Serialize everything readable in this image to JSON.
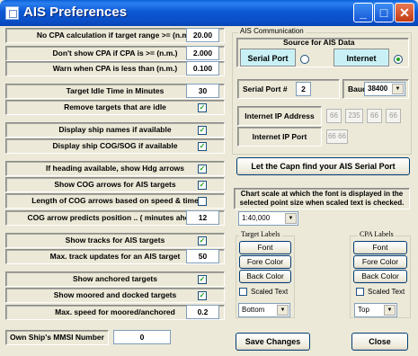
{
  "window": {
    "title": "AIS Preferences",
    "minimize_glyph": "_",
    "maximize_glyph": "□",
    "close_glyph": "✕"
  },
  "settings": [
    {
      "label": "No CPA calculation if target range >=       (n.m.)",
      "value": "20.00",
      "type": "text"
    },
    {
      "label": "Don't show CPA if CPA is >=       (n.m.)",
      "value": "2.000",
      "type": "text"
    },
    {
      "label": "Warn when CPA is less than       (n.m.)",
      "value": "0.100",
      "type": "text"
    },
    {
      "label": "Target Idle Time in Minutes",
      "value": "30",
      "type": "text"
    },
    {
      "label": "Remove targets that are idle",
      "checked": true,
      "type": "check"
    },
    {
      "label": "Display ship names if available",
      "checked": true,
      "type": "check"
    },
    {
      "label": "Display ship COG/SOG if available",
      "checked": true,
      "type": "check"
    },
    {
      "label": "If heading available, show Hdg arrows",
      "checked": true,
      "type": "check"
    },
    {
      "label": "Show COG arrows for AIS targets",
      "checked": true,
      "type": "check"
    },
    {
      "label": "Length of COG arrows based on speed & time",
      "checked": false,
      "type": "check"
    },
    {
      "label": "COG arrow predicts position .. ( minutes ahead )",
      "value": "12",
      "type": "text"
    },
    {
      "label": "Show tracks for AIS targets",
      "checked": true,
      "type": "check"
    },
    {
      "label": "Max. track updates for an AIS target",
      "value": "50",
      "type": "text"
    },
    {
      "label": "Show anchored targets",
      "checked": true,
      "type": "check"
    },
    {
      "label": "Show moored and docked targets",
      "checked": true,
      "type": "check"
    },
    {
      "label": "Max. speed  for moored/anchored",
      "value": "0.2",
      "type": "text"
    }
  ],
  "mmsi": {
    "label": "Own Ship's MMSI Number",
    "value": "0"
  },
  "ais_comm": {
    "group_label": "AIS Communication",
    "source_label": "Source for AIS Data",
    "serial_port_label": "Serial Port",
    "internet_label": "Internet",
    "serial_port_num_label": "Serial Port #",
    "serial_port_num_value": "2",
    "baud_rate_label": "Baud Rate",
    "baud_rate_value": "38400",
    "ip_address_label": "Internet IP Address",
    "ip_octets": [
      "66",
      "235",
      "66",
      "66"
    ],
    "ip_port_label": "Internet IP Port",
    "ip_port_value": "66 66"
  },
  "find_port_button": "Let the Capn find your AIS Serial Port",
  "chart_scale_text": "Chart scale at which the font is displayed in the selected point size when scaled text is checked.",
  "scale_value": "1:40,000",
  "target_labels": {
    "group_label": "Target Labels",
    "font": "Font",
    "fore_color": "Fore Color",
    "back_color": "Back Color",
    "scaled_text": "Scaled Text",
    "position": "Bottom"
  },
  "cpa_labels": {
    "group_label": "CPA Labels",
    "font": "Font",
    "fore_color": "Fore Color",
    "back_color": "Back Color",
    "scaled_text": "Scaled Text",
    "position": "Top"
  },
  "save_button": "Save Changes",
  "close_button": "Close",
  "check_glyph": "✓",
  "dropdown_glyph": "▼"
}
